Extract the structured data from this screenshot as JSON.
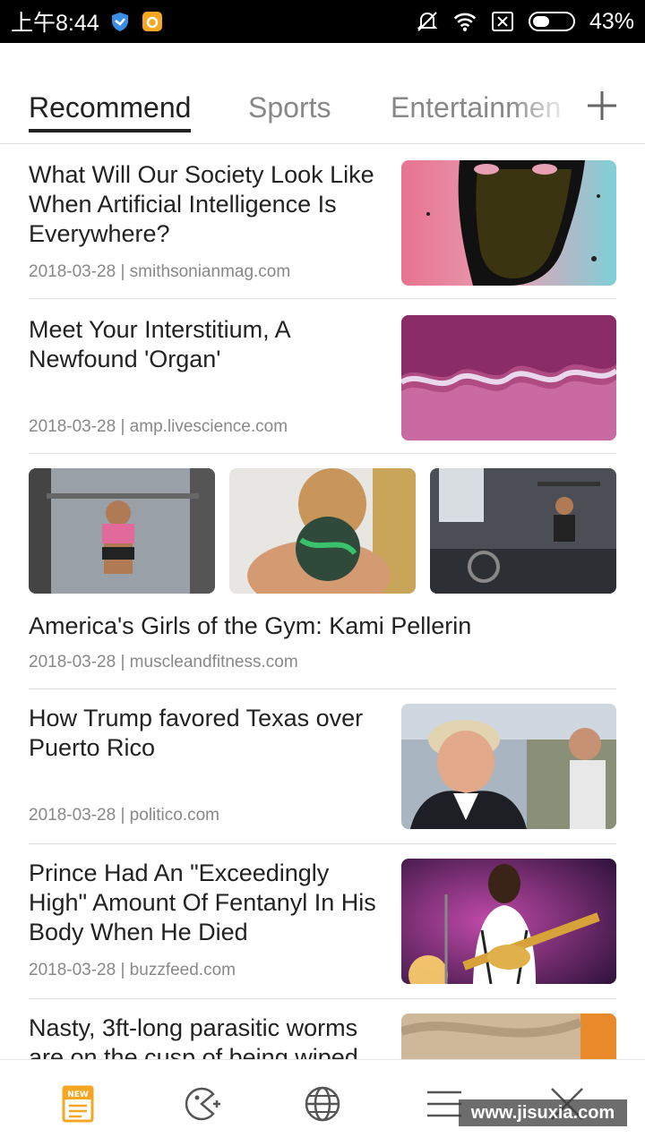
{
  "status_bar": {
    "time": "上午8:44",
    "battery": "43%",
    "battery_level": 0.43
  },
  "tabs": [
    {
      "label": "Recommend",
      "active": true
    },
    {
      "label": "Sports",
      "active": false
    },
    {
      "label": "Entertainmen",
      "active": false
    }
  ],
  "feed": [
    {
      "title": "What Will Our Society Look Like When Artificial Intelligence Is Everywhere?",
      "meta": "2018-03-28 | smithsonianmag.com",
      "image": "ai-face-illustration"
    },
    {
      "title": "Meet Your Interstitium, A Newfound 'Organ'",
      "meta": "2018-03-28 | amp.livescience.com",
      "image": "tissue-micrograph"
    },
    {
      "title": "America's Girls of the Gym: Kami Pellerin",
      "meta": "2018-03-28 | muscleandfitness.com",
      "images": [
        "gym-photo-1",
        "gym-photo-2",
        "gym-photo-3"
      ]
    },
    {
      "title": "How Trump favored Texas over Puerto Rico",
      "meta": "2018-03-28 | politico.com",
      "image": "trump-photo"
    },
    {
      "title": "Prince Had An \"Exceedingly High\" Amount Of Fentanyl In His Body When He Died",
      "meta": "2018-03-28 | buzzfeed.com",
      "image": "prince-concert-photo"
    },
    {
      "title": "Nasty, 3ft-long parasitic worms are on the cusp of being wiped",
      "image": "worm-photo"
    }
  ],
  "bottom_nav": [
    "news-icon",
    "game-icon",
    "globe-icon",
    "menu-icon",
    "close-icon"
  ],
  "watermark": "www.jisuxia.com",
  "colors": {
    "accent": "#F5A623",
    "text": "#222222",
    "muted": "#888888"
  }
}
